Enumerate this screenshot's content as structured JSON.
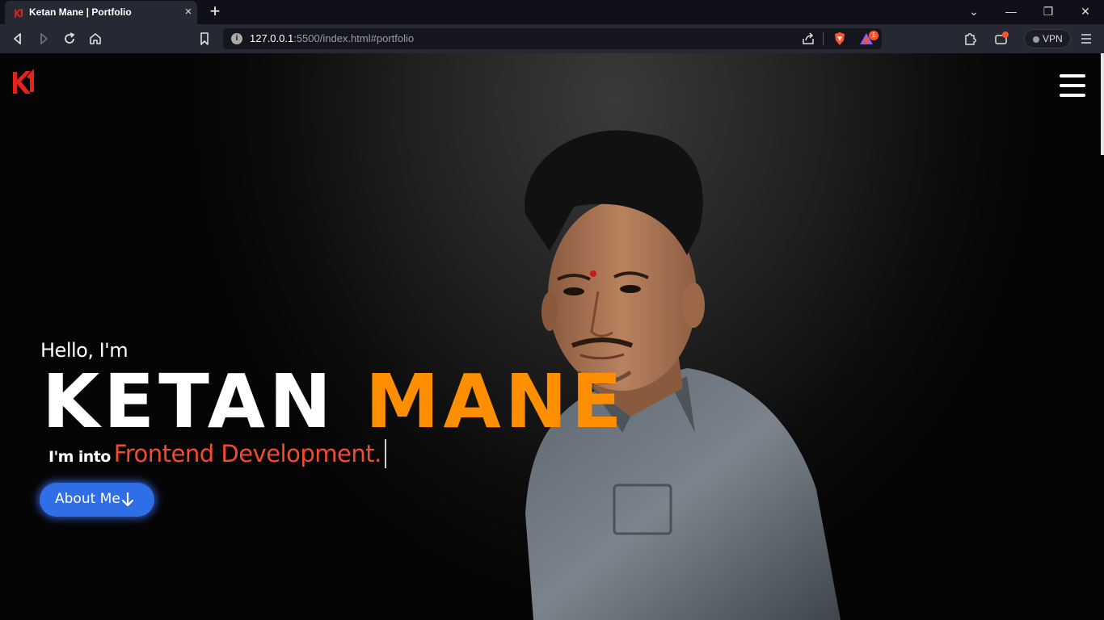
{
  "browser": {
    "tab": {
      "title": "Ketan Mane | Portfolio",
      "close": "×"
    },
    "new_tab": "+",
    "window_controls": {
      "tab_search": "⌄",
      "minimize": "—",
      "restore": "❐",
      "close": "✕"
    },
    "url": {
      "host": "127.0.0.1",
      "rest": ":5500/index.html#portfolio"
    },
    "rewards_badge": "1",
    "vpn_label": "VPN",
    "icons": [
      "back-icon",
      "forward-icon",
      "reload-icon",
      "home-icon",
      "bookmark-icon",
      "info-icon",
      "share-icon",
      "brave-shields-icon",
      "brave-rewards-icon",
      "extensions-icon",
      "wallet-icon",
      "menu-icon"
    ]
  },
  "hero": {
    "greeting": "Hello, I'm",
    "first_name": "KETAN",
    "last_name": "MANE",
    "into_prefix": "I'm into",
    "typed_role": "Frontend Development.",
    "cta_label": "About Me"
  },
  "colors": {
    "accent_orange": "#ff8f00",
    "role_red": "#f44b2e",
    "cta_blue": "#2f6ee6",
    "logo_red": "#e5231b"
  }
}
